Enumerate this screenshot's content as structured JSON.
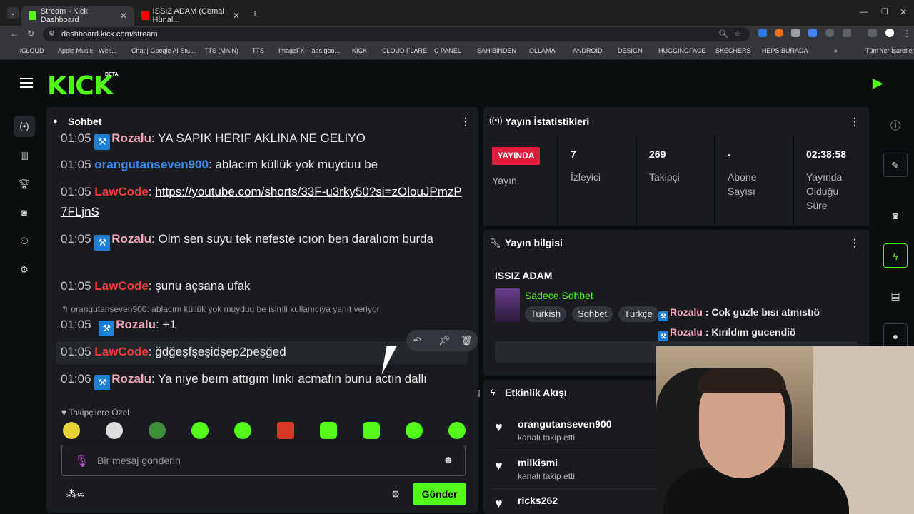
{
  "browser": {
    "tabs": [
      {
        "title": "Stream - Kick Dashboard",
        "fav_color": "#53fc18"
      },
      {
        "title": "ISSIZ ADAM (Cemal Hünal...",
        "fav_color": "#ff0000"
      }
    ],
    "url": "dashboard.kick.com/stream",
    "bookmarks": [
      "iCLOUD",
      "Apple Music - Web...",
      "Chat | Google AI Stu...",
      "TTS (MAIN)",
      "TTS",
      "ImageFX - labs.goo...",
      "KICK",
      "CLOUD FLARE",
      "C PANEL",
      "SAHIBINDEN",
      "OLLAMA",
      "ANDROID",
      "DESIGN",
      "HUGGINGFACE",
      "SKECHERS",
      "HEPSİBURADA",
      "Tüm Yer İşaretleri"
    ]
  },
  "header": {
    "logo": "KICK",
    "beta": "BETA",
    "profile_initial": "▶"
  },
  "chat": {
    "title": "Sohbet",
    "messages": [
      {
        "time": "01:05",
        "user": "Rozalu",
        "user_color": "#f4a7b9",
        "badge": true,
        "text": "YA SAPIK HERIF AKLINA NE GELIYO"
      },
      {
        "time": "01:05",
        "user": "orangutanseven900",
        "user_color": "#3b8ef0",
        "badge": false,
        "text": "ablacım küllük yok muyduu be"
      },
      {
        "time": "01:05",
        "user": "LawCode",
        "user_color": "#f03b3b",
        "badge": false,
        "text": "https://youtube.com/shorts/33F-u3rky50?si=zOlouJPmzP7FLjnS"
      },
      {
        "time": "01:05",
        "user": "Rozalu",
        "user_color": "#f4a7b9",
        "badge": true,
        "text": "Olm sen suyu tek nefeste ıcıon ben daralıom burda"
      },
      {
        "time": "01:05",
        "user": "LawCode",
        "user_color": "#f03b3b",
        "badge": false,
        "text": "şunu açsana ufak"
      },
      {
        "time": "01:05",
        "user": "Rozalu",
        "user_color": "#f4a7b9",
        "badge": true,
        "text": "+1"
      },
      {
        "time": "01:05",
        "user": "LawCode",
        "user_color": "#f03b3b",
        "badge": false,
        "text": "ğdğeşfşeşidşep2peşğed"
      },
      {
        "time": "01:06",
        "user": "Rozalu",
        "user_color": "#f4a7b9",
        "badge": true,
        "text": "Ya nıye beım attıgım lınkı acmafın bunu actın dallı"
      }
    ],
    "reply_context": "orangutanseven900: ablacım küllük yok muyduu be isimli kullanıcıya yanıt veriyor",
    "emote_label": "Takipçilere Özel",
    "input_placeholder": "Bir mesaj gönderin",
    "send_label": "Gönder"
  },
  "stats": {
    "title": "Yayın İstatistikleri",
    "live_badge": "YAYINDA",
    "live_label": "Yayın",
    "viewers": "7",
    "viewers_label": "İzleyici",
    "followers": "269",
    "followers_label": "Takipçi",
    "subs": "-",
    "subs_label_1": "Abone",
    "subs_label_2": "Sayısı",
    "uptime": "02:38:58",
    "uptime_label_1": "Yayında",
    "uptime_label_2": "Olduğu",
    "uptime_label_3": "Süre"
  },
  "info": {
    "title": "Yayın bilgisi",
    "stream_title": "ISSIZ ADAM",
    "category": "Sadece Sohbet",
    "tags": [
      "Turkish",
      "Sohbet",
      "Türkçe"
    ],
    "overlay_lines": [
      {
        "user": "Rozalu",
        "text": ": Cok guzle bısı atmıstıö"
      },
      {
        "user": "Rozalu",
        "text": ": Kırıldım gucendiö"
      }
    ]
  },
  "activity": {
    "title": "Etkinlik Akışı",
    "items": [
      {
        "name": "orangutanseven900",
        "sub": "kanalı takip etti"
      },
      {
        "name": "milkismi",
        "sub": "kanalı takip etti"
      },
      {
        "name": "ricks262",
        "sub": ""
      }
    ]
  }
}
